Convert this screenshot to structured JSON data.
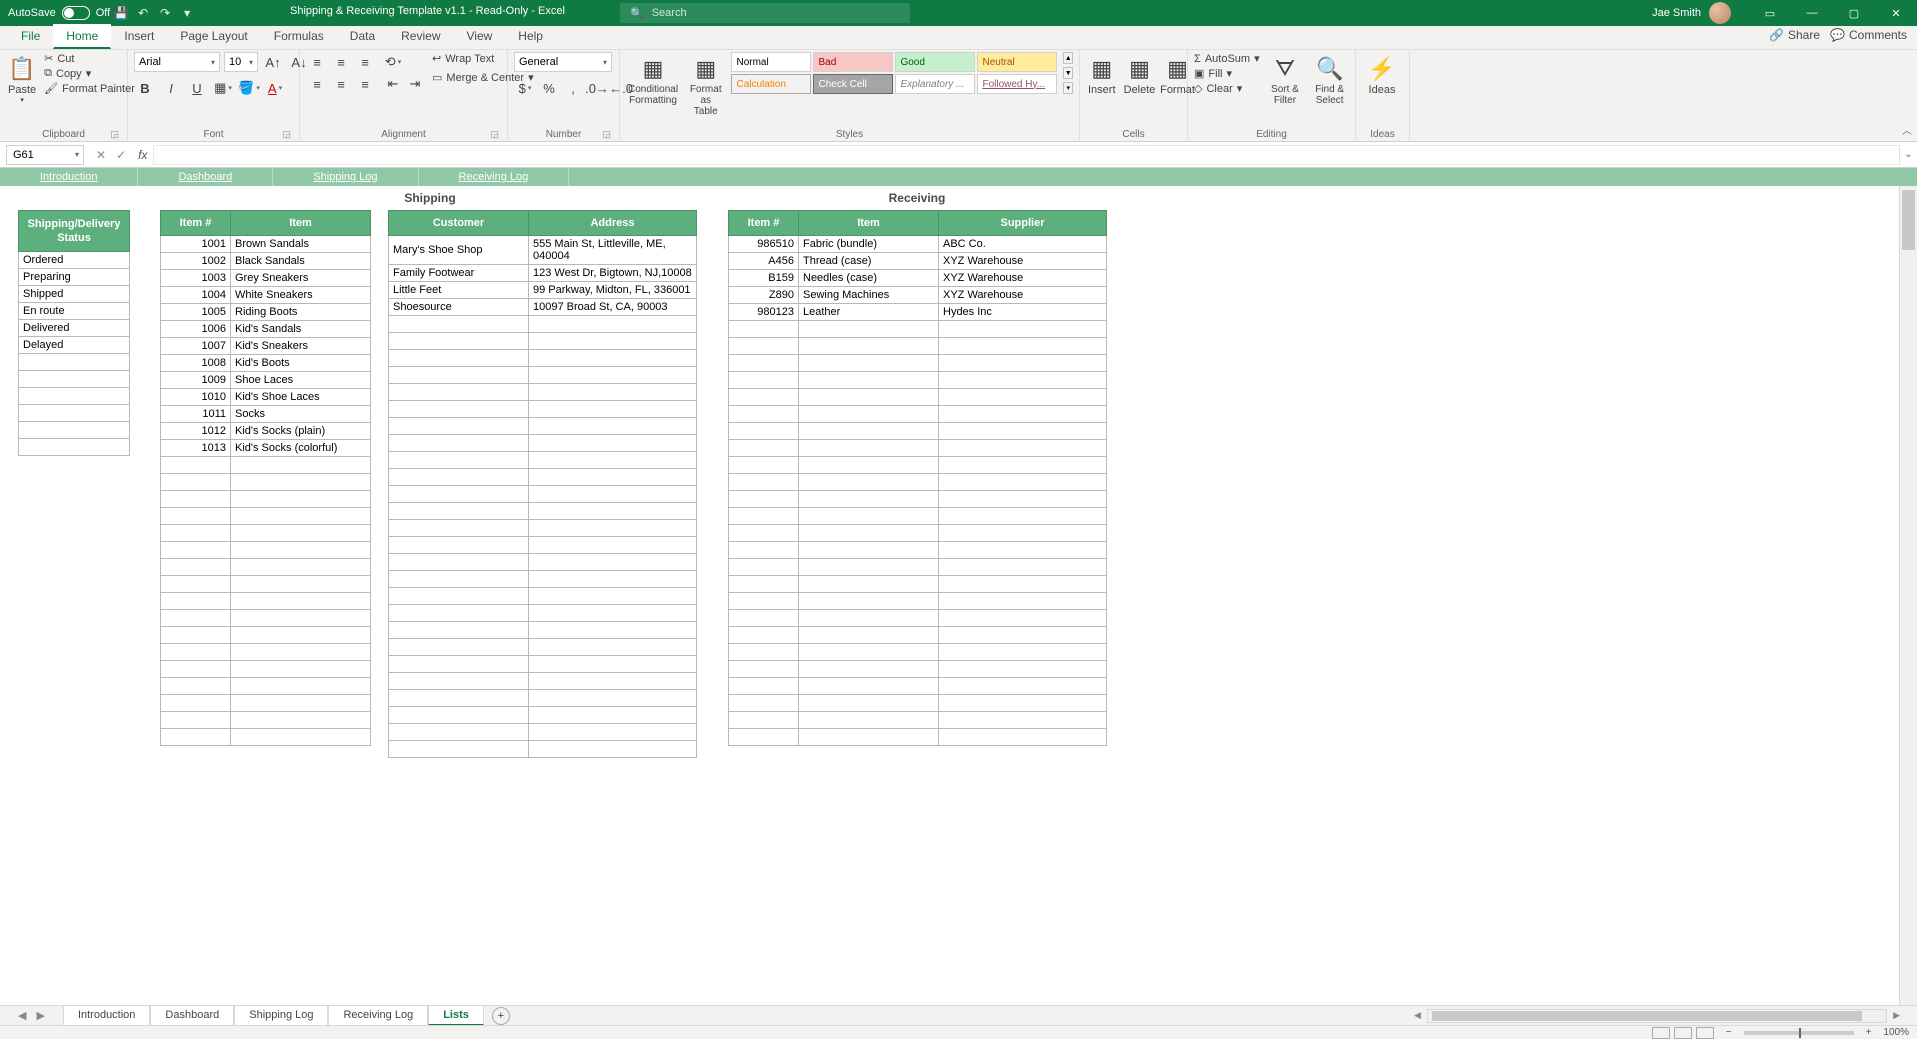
{
  "titlebar": {
    "autosave_label": "AutoSave",
    "autosave_state": "Off",
    "doc_title": "Shipping & Receiving Template v1.1  -  Read-Only  -  Excel",
    "search_placeholder": "Search",
    "user_name": "Jae Smith"
  },
  "ribbon_tabs": [
    "File",
    "Home",
    "Insert",
    "Page Layout",
    "Formulas",
    "Data",
    "Review",
    "View",
    "Help"
  ],
  "share": {
    "share": "Share",
    "comments": "Comments"
  },
  "clipboard": {
    "paste": "Paste",
    "cut": "Cut",
    "copy": "Copy",
    "painter": "Format Painter",
    "label": "Clipboard"
  },
  "font": {
    "name": "Arial",
    "size": "10",
    "label": "Font"
  },
  "alignment": {
    "wrap": "Wrap Text",
    "merge": "Merge & Center",
    "label": "Alignment"
  },
  "number": {
    "format": "General",
    "label": "Number"
  },
  "styles": {
    "cond": "Conditional Formatting",
    "fmt_table": "Format as Table",
    "gallery": [
      {
        "t": "Normal",
        "bg": "#ffffff",
        "c": "#000"
      },
      {
        "t": "Bad",
        "bg": "#f8c7c4",
        "c": "#9c0006"
      },
      {
        "t": "Good",
        "bg": "#c6efce",
        "c": "#006100"
      },
      {
        "t": "Neutral",
        "bg": "#ffeb9c",
        "c": "#9c5700"
      },
      {
        "t": "Calculation",
        "bg": "#f2f2f2",
        "c": "#fa7d00",
        "b": "1px solid #aaa"
      },
      {
        "t": "Check Cell",
        "bg": "#a5a5a5",
        "c": "#fff",
        "b": "1px solid #666"
      },
      {
        "t": "Explanatory ...",
        "bg": "#fff",
        "c": "#7f7f7f",
        "i": true
      },
      {
        "t": "Followed Hy...",
        "bg": "#fff",
        "c": "#954f72",
        "u": true
      }
    ],
    "label": "Styles"
  },
  "cells": {
    "insert": "Insert",
    "delete": "Delete",
    "format": "Format",
    "label": "Cells"
  },
  "editing": {
    "autosum": "AutoSum",
    "fill": "Fill",
    "clear": "Clear",
    "sort": "Sort & Filter",
    "find": "Find & Select",
    "label": "Editing"
  },
  "ideas": {
    "ideas": "Ideas",
    "label": "Ideas"
  },
  "namebox": "G61",
  "nav_links": [
    "Introduction",
    "Dashboard",
    "Shipping Log",
    "Receiving Log"
  ],
  "sections": {
    "shipping": "Shipping",
    "receiving": "Receiving"
  },
  "status_header": "Shipping/Delivery Status",
  "status_list": [
    "Ordered",
    "Preparing",
    "Shipped",
    "En route",
    "Delivered",
    "Delayed",
    "",
    "",
    "",
    "",
    "",
    ""
  ],
  "ship_items": {
    "headers": [
      "Item #",
      "Item"
    ],
    "rows": [
      [
        "1001",
        "Brown Sandals"
      ],
      [
        "1002",
        "Black Sandals"
      ],
      [
        "1003",
        "Grey Sneakers"
      ],
      [
        "1004",
        "White Sneakers"
      ],
      [
        "1005",
        "Riding Boots"
      ],
      [
        "1006",
        "Kid's Sandals"
      ],
      [
        "1007",
        "Kid's Sneakers"
      ],
      [
        "1008",
        "Kid's Boots"
      ],
      [
        "1009",
        "Shoe Laces"
      ],
      [
        "1010",
        "Kid's Shoe Laces"
      ],
      [
        "1011",
        "Socks"
      ],
      [
        "1012",
        "Kid's Socks (plain)"
      ],
      [
        "1013",
        "Kid's Socks (colorful)"
      ]
    ]
  },
  "customers": {
    "headers": [
      "Customer",
      "Address"
    ],
    "rows": [
      [
        "Mary's Shoe Shop",
        "555 Main St, Littleville, ME, 040004"
      ],
      [
        "Family Footwear",
        "123 West Dr, Bigtown, NJ,10008"
      ],
      [
        "Little Feet",
        "99 Parkway, Midton, FL, 336001"
      ],
      [
        "Shoesource",
        "10097 Broad St, CA, 90003"
      ]
    ]
  },
  "receiving": {
    "headers": [
      "Item #",
      "Item",
      "Supplier"
    ],
    "rows": [
      [
        "986510",
        "Fabric (bundle)",
        "ABC Co."
      ],
      [
        "A456",
        "Thread (case)",
        "XYZ Warehouse"
      ],
      [
        "B159",
        "Needles (case)",
        "XYZ Warehouse"
      ],
      [
        "Z890",
        "Sewing Machines",
        "XYZ Warehouse"
      ],
      [
        "980123",
        "Leather",
        "Hydes Inc"
      ]
    ]
  },
  "sheet_tabs": [
    "Introduction",
    "Dashboard",
    "Shipping Log",
    "Receiving Log",
    "Lists"
  ],
  "active_sheet": "Lists",
  "zoom": "100%"
}
